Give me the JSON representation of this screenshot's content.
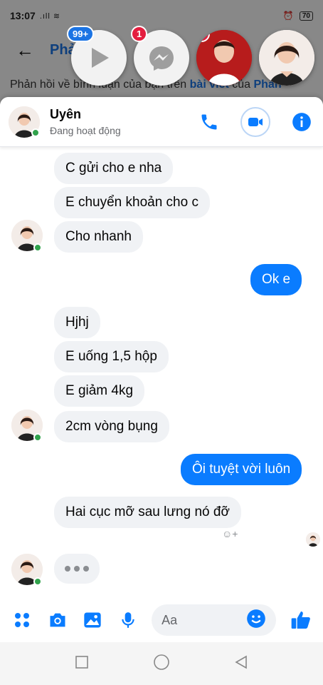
{
  "status_bar": {
    "time": "13:07",
    "battery": "70"
  },
  "background_app": {
    "title": "Phả",
    "comment_prefix": "Phản hồi về bình luận của bạn trên ",
    "comment_link": "bài viết",
    "comment_mid": " của ",
    "comment_author": "Phan"
  },
  "chat_heads": [
    {
      "name": "video-app",
      "badge": "99+"
    },
    {
      "name": "messenger",
      "badge": "1"
    },
    {
      "name": "contact-1",
      "badge": "1"
    },
    {
      "name": "contact-2",
      "badge": ""
    }
  ],
  "chat": {
    "contact_name": "Uyên",
    "contact_status": "Đang hoạt động",
    "accent": "#0a7cff"
  },
  "messages": [
    {
      "from": "them",
      "text": "C gửi cho e nha"
    },
    {
      "from": "them",
      "text": "E chuyển khoản cho c"
    },
    {
      "from": "them",
      "text": "Cho nhanh"
    },
    {
      "from": "me",
      "text": "Ok e"
    },
    {
      "from": "them",
      "text": "Hjhj"
    },
    {
      "from": "them",
      "text": "E uống 1,5 hộp"
    },
    {
      "from": "them",
      "text": "E giảm 4kg"
    },
    {
      "from": "them",
      "text": "2cm vòng bụng"
    },
    {
      "from": "me",
      "text": "Ôi tuyệt vời luôn"
    },
    {
      "from": "them",
      "text": "Hai cục mỡ sau lưng nó đỡ"
    }
  ],
  "composer": {
    "placeholder": "Aa"
  },
  "icons": {
    "back": "arrow-left-icon",
    "call": "phone-icon",
    "video": "video-camera-icon",
    "info": "info-icon",
    "apps": "grid-icon",
    "camera": "camera-icon",
    "gallery": "image-icon",
    "mic": "microphone-icon",
    "emoji": "smile-icon",
    "like": "thumbs-up-icon"
  }
}
